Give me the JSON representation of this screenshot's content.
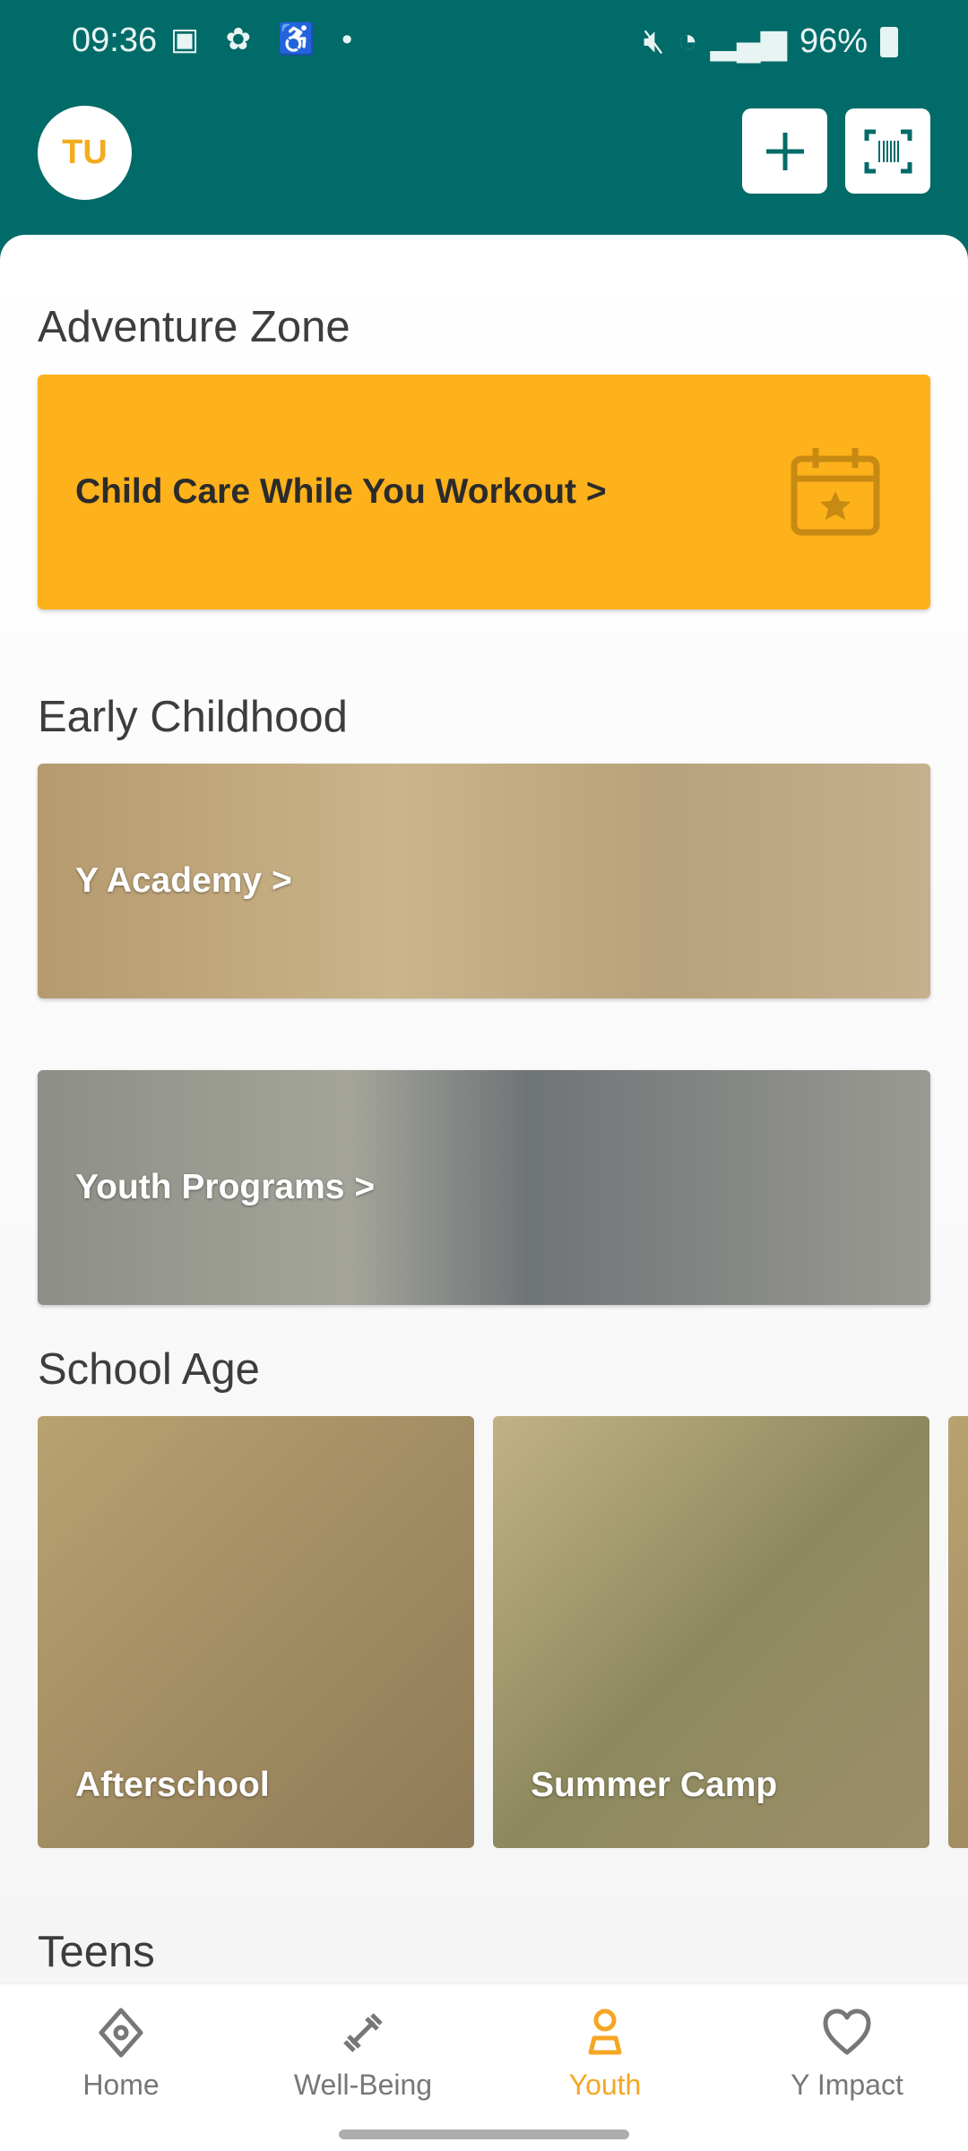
{
  "status_bar": {
    "time": "09:36",
    "battery": "96%",
    "left_icons": [
      "gallery-icon",
      "pinwheel-icon",
      "accessibility-icon",
      "dot-icon"
    ],
    "right_icons": [
      "mute-icon",
      "wifi-icon",
      "signal-icon",
      "battery-icon"
    ]
  },
  "header": {
    "avatar_initials": "TU",
    "add_button": "plus-icon",
    "scan_button": "barcode-scan-icon"
  },
  "sections": {
    "adventure": {
      "title": "Adventure Zone",
      "card": "Child Care While You Workout >"
    },
    "early": {
      "title": "Early Childhood",
      "cards": [
        "Y Academy >",
        "Youth Programs >"
      ]
    },
    "school": {
      "title": "School Age",
      "cards": [
        "Afterschool",
        "Summer Camp"
      ]
    },
    "teens": {
      "title": "Teens"
    }
  },
  "nav": {
    "items": [
      {
        "label": "Home",
        "icon": "home-diamond-icon"
      },
      {
        "label": "Well-Being",
        "icon": "dumbbell-icon"
      },
      {
        "label": "Youth",
        "icon": "person-icon",
        "active": true
      },
      {
        "label": "Y Impact",
        "icon": "heart-icon"
      }
    ]
  },
  "colors": {
    "header": "#006b68",
    "accent": "#fdb11b",
    "active_nav": "#f5a623"
  }
}
